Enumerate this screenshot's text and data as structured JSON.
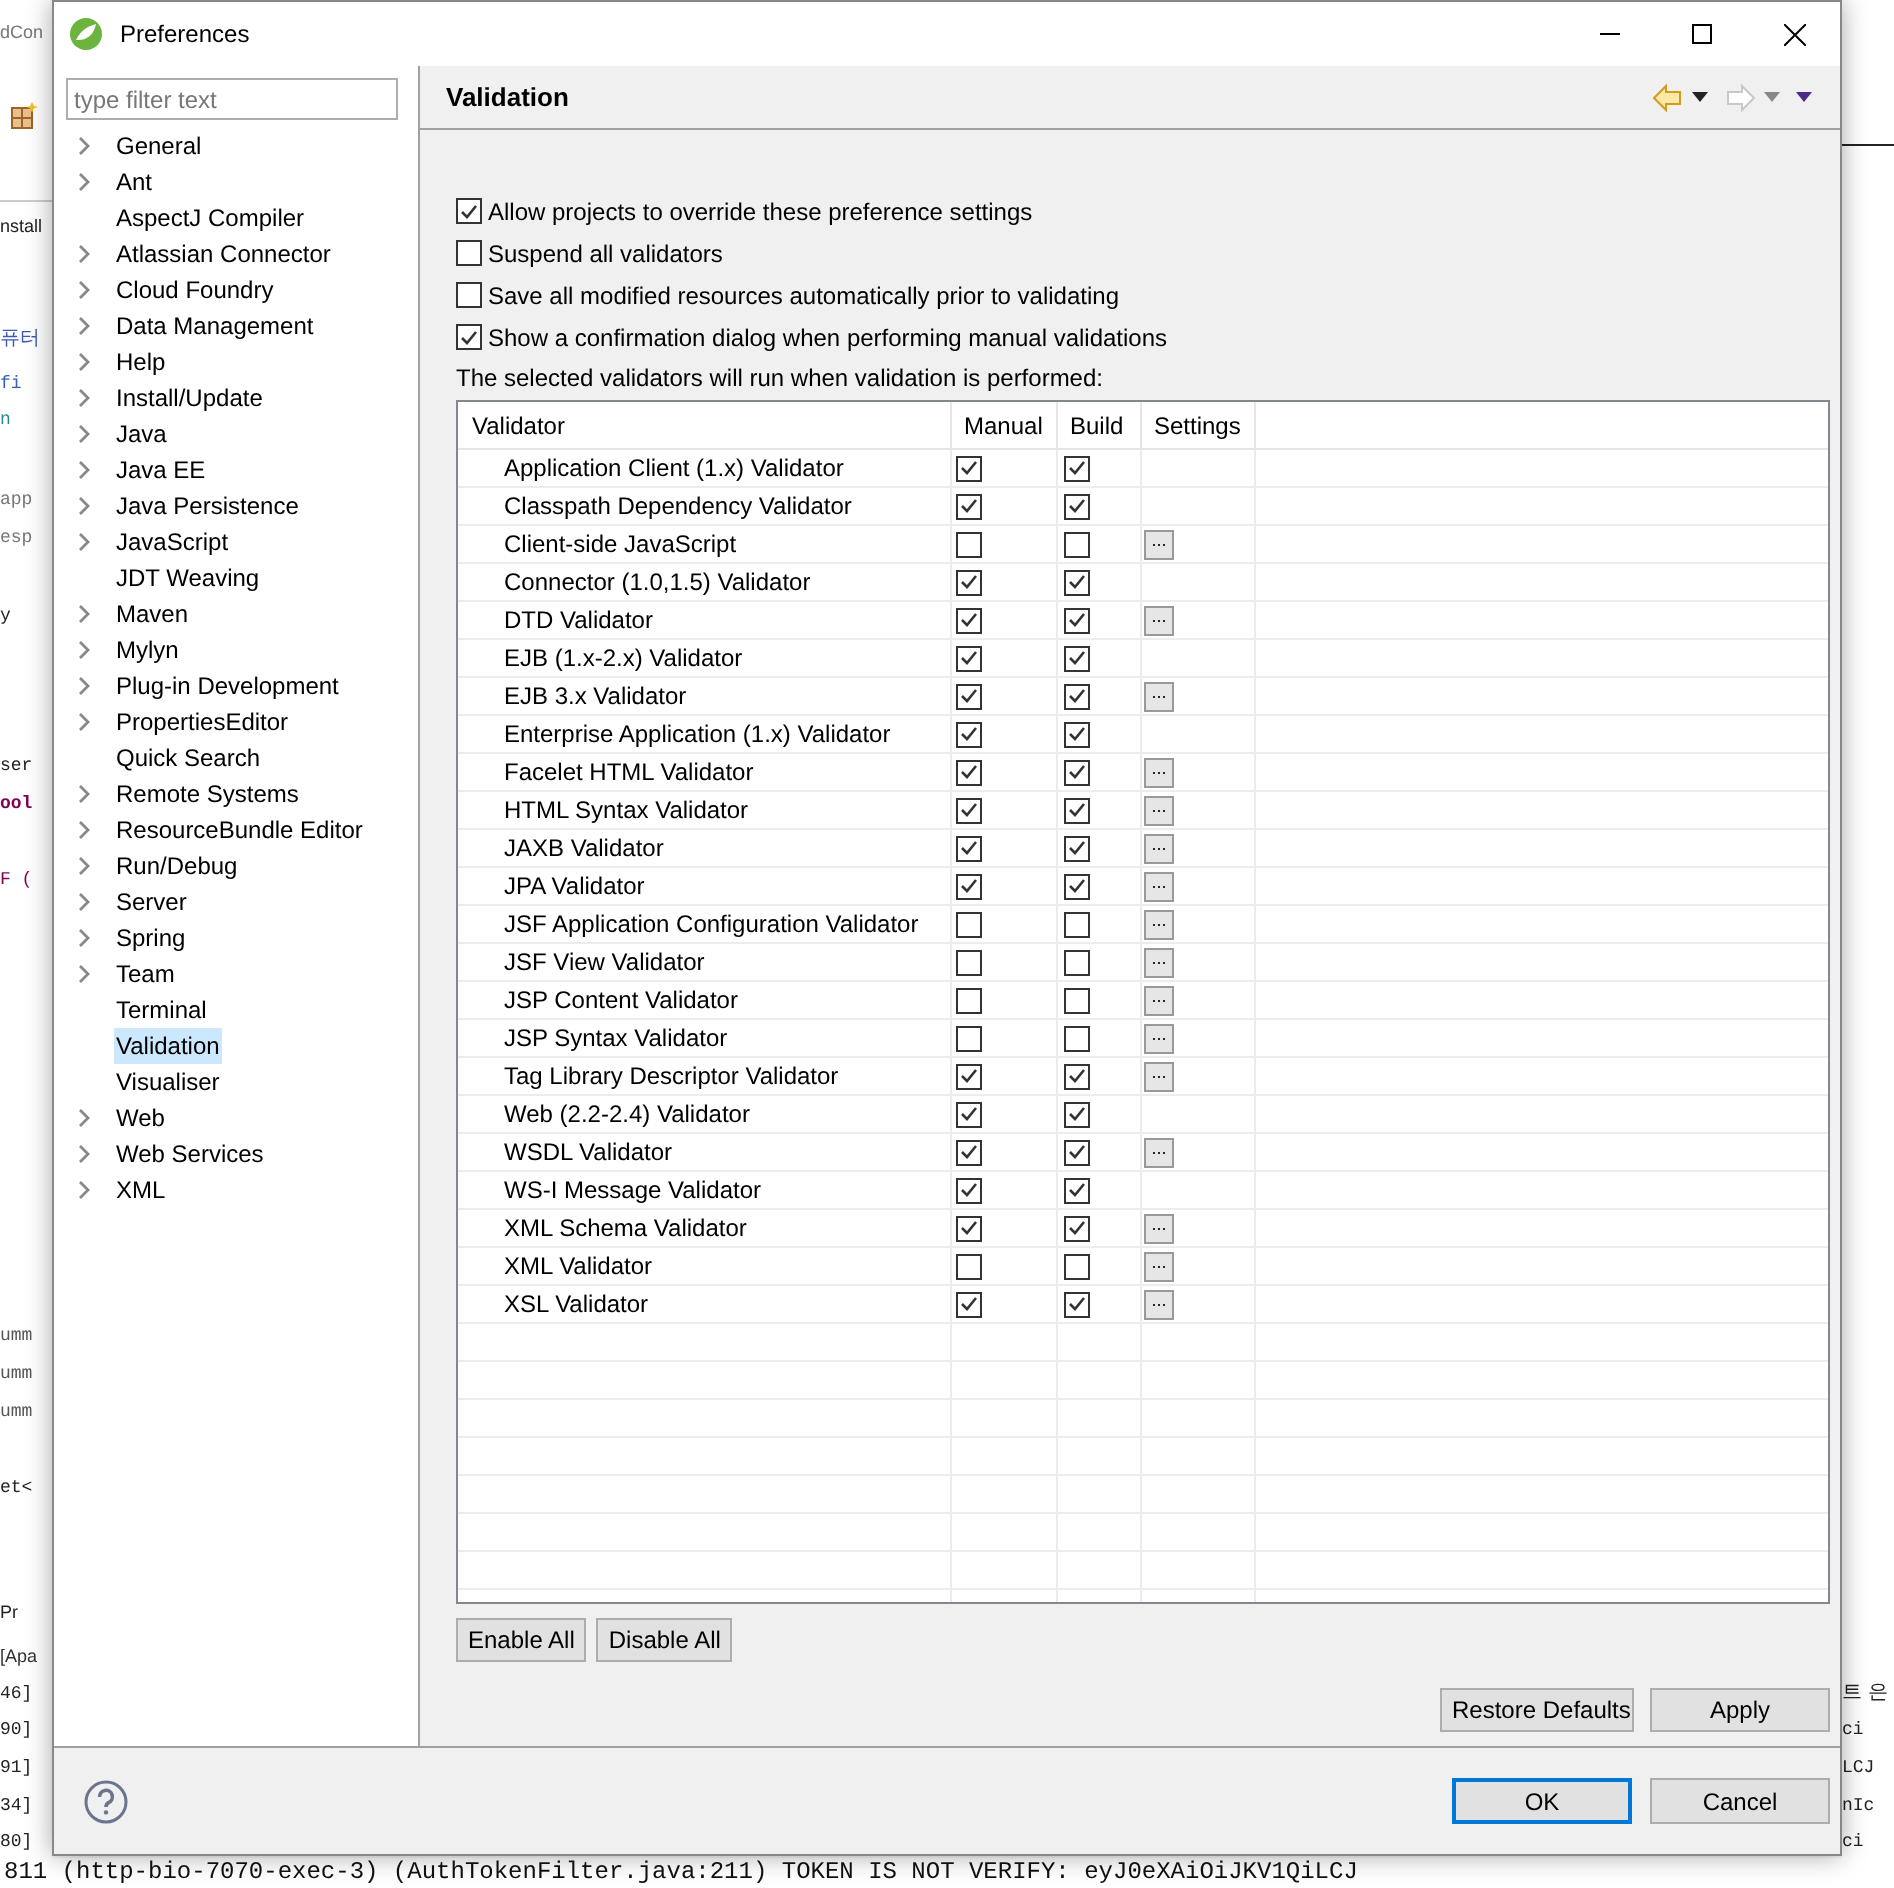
{
  "background": {
    "left_fragments": [
      "dCon",
      "nstall",
      "퓨터",
      "fi",
      "n",
      "app",
      "esp",
      "y",
      "ser",
      "ool",
      "F (",
      "umm",
      "umm",
      "umm",
      "et<",
      "Pr",
      "[Apa",
      "46]",
      "90]",
      "91]",
      "34]",
      "80]"
    ],
    "right_fragments": [
      "트 은",
      "ci",
      "LCJ",
      "nIc",
      "ci"
    ],
    "console_line": "811 (http-bio-7070-exec-3) (AuthTokenFilter.java:211) TOKEN IS NOT VERIFY: eyJ0eXAiOiJKV1QiLCJ"
  },
  "window": {
    "title": "Preferences"
  },
  "filter": {
    "placeholder": "type filter text"
  },
  "tree": [
    {
      "label": "General",
      "expandable": true,
      "selected": false
    },
    {
      "label": "Ant",
      "expandable": true,
      "selected": false
    },
    {
      "label": "AspectJ Compiler",
      "expandable": false,
      "selected": false
    },
    {
      "label": "Atlassian Connector",
      "expandable": true,
      "selected": false
    },
    {
      "label": "Cloud Foundry",
      "expandable": true,
      "selected": false
    },
    {
      "label": "Data Management",
      "expandable": true,
      "selected": false
    },
    {
      "label": "Help",
      "expandable": true,
      "selected": false
    },
    {
      "label": "Install/Update",
      "expandable": true,
      "selected": false
    },
    {
      "label": "Java",
      "expandable": true,
      "selected": false
    },
    {
      "label": "Java EE",
      "expandable": true,
      "selected": false
    },
    {
      "label": "Java Persistence",
      "expandable": true,
      "selected": false
    },
    {
      "label": "JavaScript",
      "expandable": true,
      "selected": false
    },
    {
      "label": "JDT Weaving",
      "expandable": false,
      "selected": false
    },
    {
      "label": "Maven",
      "expandable": true,
      "selected": false
    },
    {
      "label": "Mylyn",
      "expandable": true,
      "selected": false
    },
    {
      "label": "Plug-in Development",
      "expandable": true,
      "selected": false
    },
    {
      "label": "PropertiesEditor",
      "expandable": true,
      "selected": false
    },
    {
      "label": "Quick Search",
      "expandable": false,
      "selected": false
    },
    {
      "label": "Remote Systems",
      "expandable": true,
      "selected": false
    },
    {
      "label": "ResourceBundle Editor",
      "expandable": true,
      "selected": false
    },
    {
      "label": "Run/Debug",
      "expandable": true,
      "selected": false
    },
    {
      "label": "Server",
      "expandable": true,
      "selected": false
    },
    {
      "label": "Spring",
      "expandable": true,
      "selected": false
    },
    {
      "label": "Team",
      "expandable": true,
      "selected": false
    },
    {
      "label": "Terminal",
      "expandable": false,
      "selected": false
    },
    {
      "label": "Validation",
      "expandable": false,
      "selected": true
    },
    {
      "label": "Visualiser",
      "expandable": false,
      "selected": false
    },
    {
      "label": "Web",
      "expandable": true,
      "selected": false
    },
    {
      "label": "Web Services",
      "expandable": true,
      "selected": false
    },
    {
      "label": "XML",
      "expandable": true,
      "selected": false
    }
  ],
  "page": {
    "title": "Validation",
    "back_enabled": true,
    "forward_enabled": false
  },
  "options": [
    {
      "label": "Allow projects to override these preference settings",
      "checked": true
    },
    {
      "label": "Suspend all validators",
      "checked": false
    },
    {
      "label": "Save all modified resources automatically prior to validating",
      "checked": false
    },
    {
      "label": "Show a confirmation dialog when performing manual validations",
      "checked": true
    }
  ],
  "note": "The selected validators will run when validation is performed:",
  "table": {
    "columns": [
      "Validator",
      "Manual",
      "Build",
      "Settings"
    ],
    "rows": [
      {
        "name": "Application Client (1.x) Validator",
        "manual": true,
        "build": true
      },
      {
        "name": "Classpath Dependency Validator",
        "manual": true,
        "build": true
      },
      {
        "name": "Client-side JavaScript",
        "manual": false,
        "build": false,
        "settings_button": "..."
      },
      {
        "name": "Connector (1.0,1.5) Validator",
        "manual": true,
        "build": true
      },
      {
        "name": "DTD Validator",
        "manual": true,
        "build": true,
        "settings_button": "..."
      },
      {
        "name": "EJB (1.x-2.x) Validator",
        "manual": true,
        "build": true
      },
      {
        "name": "EJB 3.x Validator",
        "manual": true,
        "build": true,
        "settings_button": "..."
      },
      {
        "name": "Enterprise Application (1.x) Validator",
        "manual": true,
        "build": true
      },
      {
        "name": "Facelet HTML Validator",
        "manual": true,
        "build": true,
        "settings_button": "..."
      },
      {
        "name": "HTML Syntax Validator",
        "manual": true,
        "build": true,
        "settings_button": "..."
      },
      {
        "name": "JAXB Validator",
        "manual": true,
        "build": true,
        "settings_button": "..."
      },
      {
        "name": "JPA Validator",
        "manual": true,
        "build": true,
        "settings_button": "..."
      },
      {
        "name": "JSF Application Configuration Validator",
        "manual": false,
        "build": false,
        "settings_button": "..."
      },
      {
        "name": "JSF View Validator",
        "manual": false,
        "build": false,
        "settings_button": "..."
      },
      {
        "name": "JSP Content Validator",
        "manual": false,
        "build": false,
        "settings_button": "..."
      },
      {
        "name": "JSP Syntax Validator",
        "manual": false,
        "build": false,
        "settings_button": "..."
      },
      {
        "name": "Tag Library Descriptor Validator",
        "manual": true,
        "build": true,
        "settings_button": "..."
      },
      {
        "name": "Web (2.2-2.4) Validator",
        "manual": true,
        "build": true
      },
      {
        "name": "WSDL Validator",
        "manual": true,
        "build": true,
        "settings_button": "..."
      },
      {
        "name": "WS-I Message Validator",
        "manual": true,
        "build": true
      },
      {
        "name": "XML Schema Validator",
        "manual": true,
        "build": true,
        "settings_button": "..."
      },
      {
        "name": "XML Validator",
        "manual": false,
        "build": false,
        "settings_button": "..."
      },
      {
        "name": "XSL Validator",
        "manual": true,
        "build": true,
        "settings_button": "..."
      }
    ]
  },
  "table_buttons": [
    "Enable All",
    "Disable All"
  ],
  "page_buttons": [
    "Restore Defaults",
    "Apply"
  ],
  "dialog_buttons": [
    {
      "label": "OK",
      "default": true
    },
    {
      "label": "Cancel",
      "default": false
    }
  ]
}
